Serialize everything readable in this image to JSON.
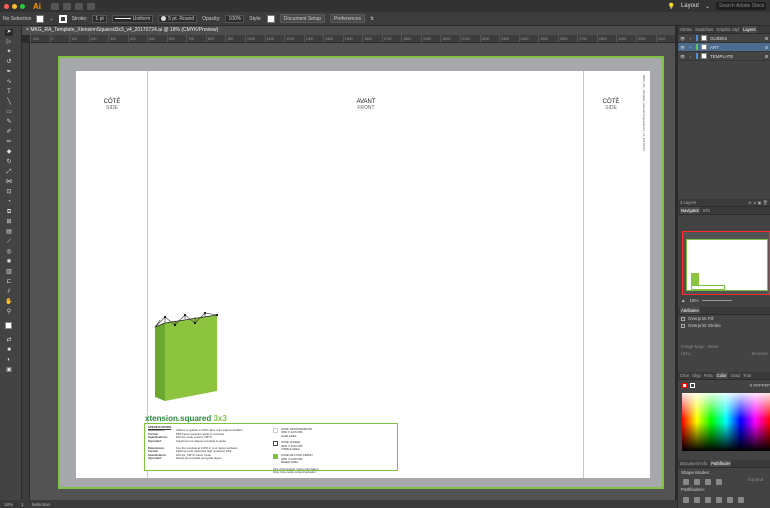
{
  "menubar": {
    "app_logo": "Ai",
    "workspace": "Layout",
    "search_placeholder": "Search Adobe Stock"
  },
  "controlbar": {
    "selection": "No Selection",
    "stroke_label": "Stroke:",
    "stroke_weight": "1 pt",
    "profile": "Uniform",
    "brush": "5 pt. Round",
    "opacity_label": "Opacity:",
    "opacity_value": "100%",
    "style_label": "Style:",
    "doc_setup": "Document Setup",
    "preferences": "Preferences"
  },
  "document": {
    "tab_title": "MKG_RA_Template_XtensionSquared3x3_v4_20170724.ai @ 18% (CMYK/Preview)",
    "ruler_ticks": [
      "-100",
      "0",
      "100",
      "200",
      "300",
      "400",
      "500",
      "600",
      "700",
      "800",
      "900",
      "1000",
      "1100",
      "1200",
      "1300",
      "1400",
      "1500",
      "1600",
      "1700",
      "1800",
      "1900",
      "2000",
      "2100",
      "2200",
      "2300",
      "2400",
      "2500",
      "2600",
      "2700",
      "2800",
      "2900",
      "3000",
      "3100"
    ]
  },
  "artboard": {
    "left_label": "CÔTÉ",
    "left_label_en": "SIDE",
    "center_label": "AVANT",
    "center_label_en": "FRONT",
    "right_label": "CÔTÉ",
    "right_label_en": "SIDE",
    "vertical_note": "MKG_RA_Template_XtensionSquared3x3_v4_20170724",
    "brand_name": "xtension.squared",
    "brand_size": "3x3",
    "specs": {
      "heading": "SPECIFICATIONS",
      "fr": [
        {
          "k": "Dimensions:",
          "v": "Utilisez ce gabarit à 100% dans votre logiciel d'édition"
        },
        {
          "k": "Format:",
          "v": "PDF haute résolution aplat et vectorisé"
        },
        {
          "k": "Spécifications:",
          "v": "100 dpi mode couleur CMYK"
        },
        {
          "k": "Important:",
          "v": "Supprimer les calques template et guide"
        }
      ],
      "en": [
        {
          "k": "Dimensions:",
          "v": "Use the template at 100% in your design software"
        },
        {
          "k": "Format:",
          "v": "Flattened and rasterized high resolution PDF"
        },
        {
          "k": "Specification:",
          "v": "100 dpi, CMYK colour mode"
        },
        {
          "k": "Important:",
          "v": "Delete the template and guide layers"
        }
      ],
      "legend": [
        {
          "fr": "ZONE TRANSPARENTE",
          "sub": "3060 X 2215 MM",
          "en": "SAFE AREA"
        },
        {
          "fr": "ZONE VISIBLE",
          "sub": "3060 X 2210 MM",
          "en": "VISIBLE AREA"
        },
        {
          "fr": "ZONE DE FOND PERDU",
          "sub": "3060 X 2230 MM",
          "en": "BLEED AREA"
        }
      ],
      "more_info": "Plus d'information | More information:",
      "more_info_url": "https://xpo.ca/wp-content/uploads/..."
    }
  },
  "panels": {
    "top_tabs": [
      "Stroke",
      "Swatches",
      "Graphic Styl",
      "Layers"
    ],
    "layers": [
      {
        "name": "GUIDES",
        "color": "#4f8fe0"
      },
      {
        "name": "ART",
        "color": "#5ac75a"
      },
      {
        "name": "TEMPLATE",
        "color": "#4f8fe0"
      }
    ],
    "layers_count": "3 Layers",
    "nav_tabs": [
      "Navigator",
      "Info"
    ],
    "zoom": "18%",
    "attributes_title": "Attributes",
    "overprint_fill": "Overprint Fill",
    "overprint_stroke": "Overprint Stroke",
    "image_map_label": "Image Map:",
    "image_map_value": "None",
    "url_label": "URL:",
    "url_placeholder": "",
    "browser_label": "Browser",
    "color_tabs": [
      "Char",
      "Glyp",
      "Para",
      "Color",
      "Grad",
      "Tran"
    ],
    "color_hex": "FFFFFF",
    "pathfinder_tabs": [
      "Document Info",
      "Pathfinder"
    ],
    "shape_modes": "Shape Modes:",
    "expand": "Expand",
    "pathfinders": "Pathfinders:"
  },
  "statusbar": {
    "zoom": "18%",
    "artboard_num": "1",
    "tool": "Selection"
  },
  "colors": {
    "accent_green": "#7ec242",
    "brand_dark_green": "#2a8a3c",
    "layer_selected": "#4b6b8f"
  }
}
